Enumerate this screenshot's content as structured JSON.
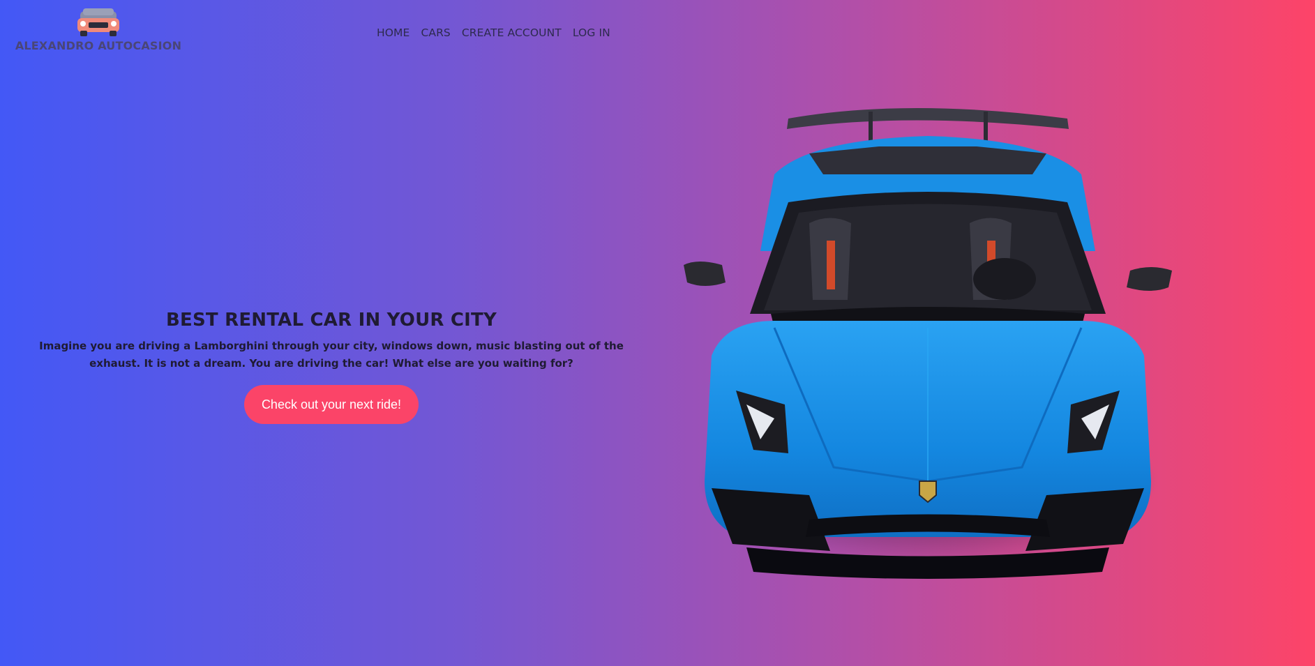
{
  "brand": {
    "name": "ALEXANDRO AUTOCASION",
    "logo_icon": "car-logo-icon"
  },
  "nav": {
    "items": [
      {
        "label": "HOME"
      },
      {
        "label": "CARS"
      },
      {
        "label": "CREATE ACCOUNT"
      },
      {
        "label": "LOG IN"
      }
    ]
  },
  "hero": {
    "title": "BEST RENTAL CAR IN YOUR CITY",
    "description": "Imagine you are driving a Lamborghini through your city, windows down, music blasting out of the exhaust. It is not a dream. You are driving the car! What else are you waiting for?",
    "cta_label": "Check out your next ride!",
    "image_subject": "blue-sports-car-image"
  },
  "colors": {
    "gradient_start": "#4358f6",
    "gradient_end": "#fd4468",
    "cta_background": "#fb4468",
    "car_body": "#1e8fe6"
  }
}
